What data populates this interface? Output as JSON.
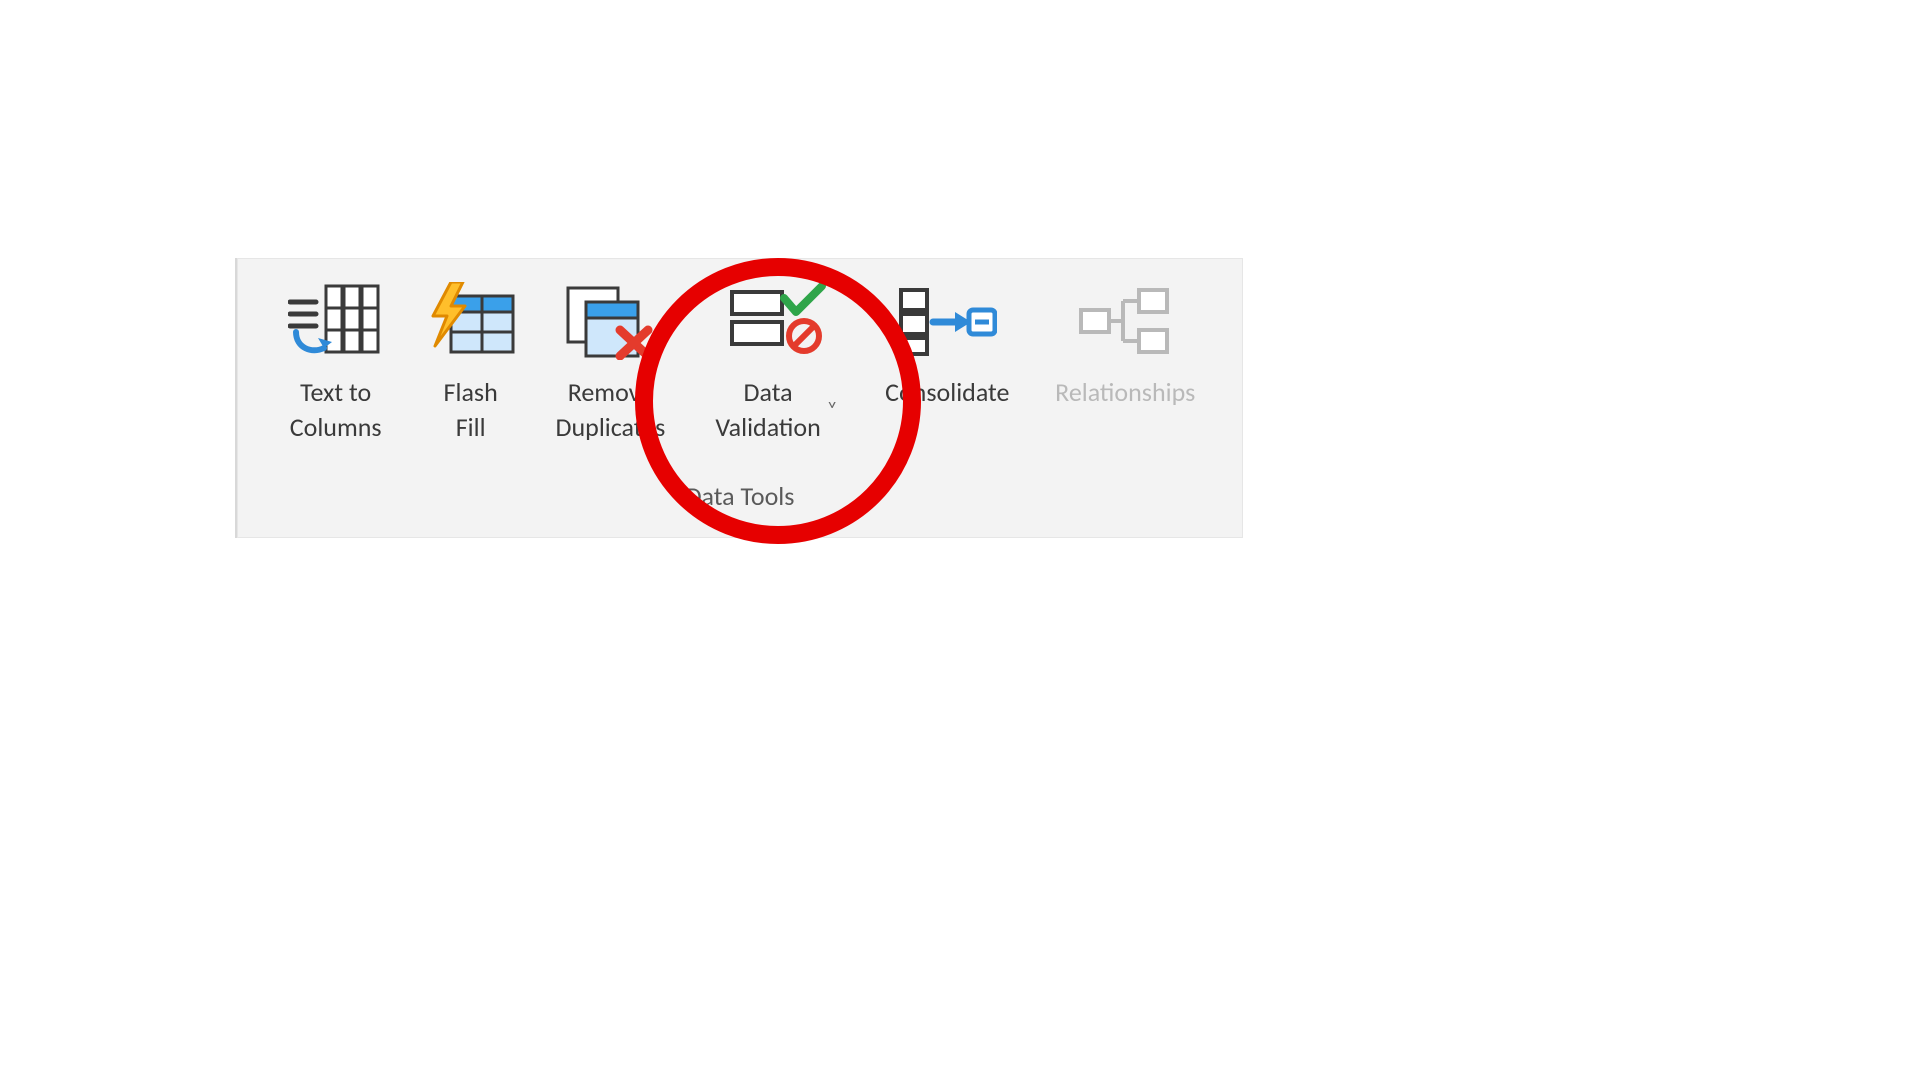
{
  "ribbon": {
    "group_name": "Data Tools",
    "buttons": {
      "text_to_columns": {
        "label": "Text to\nColumns",
        "disabled": false
      },
      "flash_fill": {
        "label": "Flash\nFill",
        "disabled": false
      },
      "remove_dup": {
        "label": "Remove\nDuplicates",
        "disabled": false
      },
      "data_validation": {
        "label": "Data\nValidation",
        "disabled": false,
        "dropdown": "˅"
      },
      "consolidate": {
        "label": "Consolidate",
        "disabled": false
      },
      "relationships": {
        "label": "Relationships",
        "disabled": true
      }
    }
  },
  "annotation": {
    "highlighted": "data_validation"
  }
}
